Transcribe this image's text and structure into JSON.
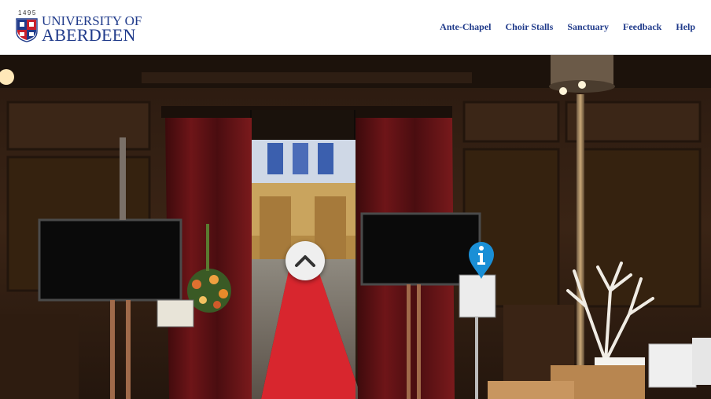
{
  "brand": {
    "year": "1495",
    "line1": "UNIVERSITY OF",
    "line2": "ABERDEEN"
  },
  "nav": {
    "items": [
      "Ante-Chapel",
      "Choir Stalls",
      "Sanctuary",
      "Feedback",
      "Help"
    ]
  },
  "hotspots": {
    "forward_icon": "chevron-up-icon",
    "info_icon": "info-pin-icon",
    "info_color": "#1a8fd6"
  },
  "colors": {
    "brand_blue": "#1f3a8a",
    "carpet_red": "#d8262e"
  }
}
